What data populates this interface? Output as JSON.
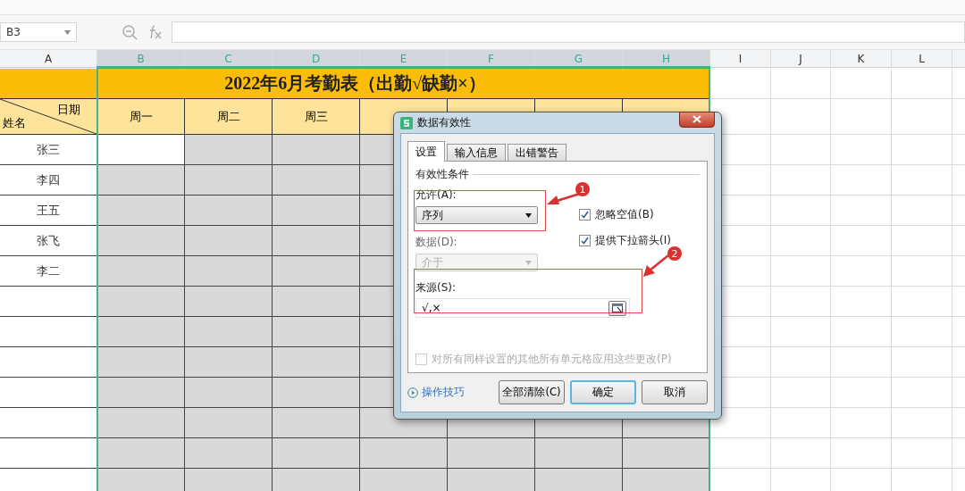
{
  "name_box": {
    "value": "B3"
  },
  "columns": [
    {
      "label": "A",
      "selected": false
    },
    {
      "label": "B",
      "selected": true
    },
    {
      "label": "C",
      "selected": true
    },
    {
      "label": "D",
      "selected": true
    },
    {
      "label": "E",
      "selected": true
    },
    {
      "label": "F",
      "selected": true
    },
    {
      "label": "G",
      "selected": true
    },
    {
      "label": "H",
      "selected": true
    },
    {
      "label": "I",
      "selected": false
    },
    {
      "label": "J",
      "selected": false
    },
    {
      "label": "K",
      "selected": false
    },
    {
      "label": "L",
      "selected": false
    }
  ],
  "sheet": {
    "title": "2022年6月考勤表（出勤√缺勤×）",
    "corner_top": "日期",
    "corner_bottom": "姓名",
    "weekdays": [
      "周一",
      "周二",
      "周三"
    ],
    "rows": [
      {
        "name": "张三",
        "active": true
      },
      {
        "name": "李四",
        "active": false
      },
      {
        "name": "王五",
        "active": false
      },
      {
        "name": "张飞",
        "active": false
      },
      {
        "name": "李二",
        "active": false
      }
    ]
  },
  "dialog": {
    "title": "数据有效性",
    "tabs": [
      {
        "label": "设置",
        "selected": true
      },
      {
        "label": "输入信息",
        "selected": false
      },
      {
        "label": "出错警告",
        "selected": false
      }
    ],
    "group_title": "有效性条件",
    "allow": {
      "label": "允许(A):",
      "value": "序列",
      "disabled": false
    },
    "data": {
      "label": "数据(D):",
      "value": "介于",
      "disabled": true
    },
    "options": [
      {
        "label": "忽略空值(B)",
        "checked": true,
        "disabled": false
      },
      {
        "label": "提供下拉箭头(I)",
        "checked": true,
        "disabled": false
      }
    ],
    "source": {
      "label": "来源(S):",
      "value": "√,×"
    },
    "apply_all": {
      "label": "对所有同样设置的其他所有单元格应用这些更改(P)",
      "checked": false,
      "disabled": true
    },
    "tips_link": "操作技巧",
    "buttons": [
      {
        "label": "全部清除(C)",
        "default": false
      },
      {
        "label": "确定",
        "default": true
      },
      {
        "label": "取消",
        "default": false
      }
    ]
  },
  "annotations": [
    {
      "label": "1"
    },
    {
      "label": "2"
    }
  ]
}
